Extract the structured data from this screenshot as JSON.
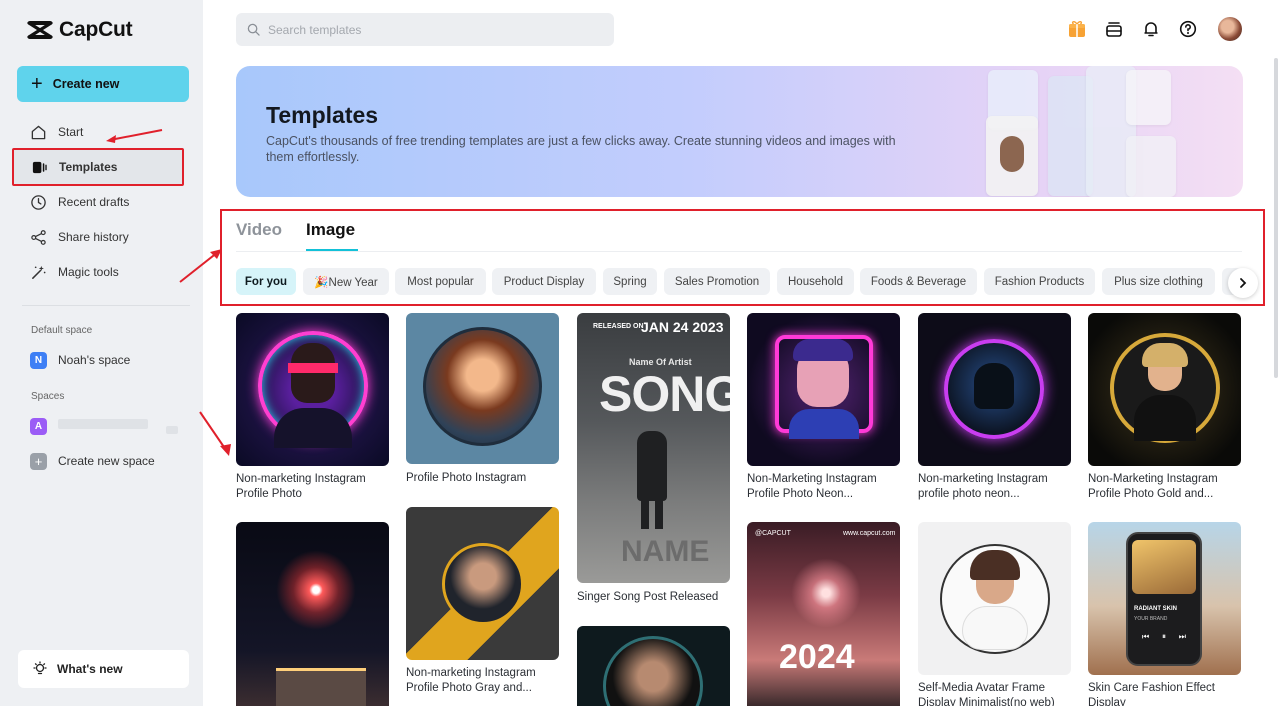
{
  "app": {
    "logo_text": "CapCut"
  },
  "sidebar": {
    "create_label": "Create new",
    "nav": [
      {
        "label": "Start",
        "icon": "home-icon"
      },
      {
        "label": "Templates",
        "icon": "templates-icon"
      },
      {
        "label": "Recent drafts",
        "icon": "clock-icon"
      },
      {
        "label": "Share history",
        "icon": "share-icon"
      },
      {
        "label": "Magic tools",
        "icon": "magic-wand-icon"
      }
    ],
    "default_space_label": "Default space",
    "default_space": {
      "badge": "N",
      "name": "Noah's space",
      "color": "#3d7ff5"
    },
    "spaces_label": "Spaces",
    "spaces_badge": "A",
    "spaces_badge_color": "#9b5cf6",
    "create_space_label": "Create new space",
    "whats_new_label": "What's new"
  },
  "header": {
    "search_placeholder": "Search templates"
  },
  "banner": {
    "title": "Templates",
    "description": "CapCut's thousands of free trending templates are just a few clicks away. Create stunning videos and images with them effortlessly."
  },
  "tabs": [
    {
      "label": "Video",
      "active": false
    },
    {
      "label": "Image",
      "active": true
    }
  ],
  "chips": [
    "For you",
    "🎉New Year",
    "Most popular",
    "Product Display",
    "Spring",
    "Sales Promotion",
    "Household",
    "Foods & Beverage",
    "Fashion Products",
    "Plus size clothing"
  ],
  "templates": [
    {
      "caption": "Non-marketing Instagram Profile Photo"
    },
    {
      "caption": "Profile Photo Instagram"
    },
    {
      "caption": "Singer Song Post Released",
      "overlay_top": "RELEASED ON",
      "overlay_date": "JAN 24 2023",
      "overlay_artist": "Name Of Artist",
      "overlay_title": "SONG",
      "overlay_name": "NAME"
    },
    {
      "caption": "Non-Marketing Instagram Profile Photo Neon..."
    },
    {
      "caption": "Non-marketing Instagram profile photo neon..."
    },
    {
      "caption": "Non-Marketing Instagram Profile Photo Gold and..."
    },
    {
      "caption": ""
    },
    {
      "caption": "Non-marketing Instagram Profile Photo Gray and..."
    },
    {
      "caption": ""
    },
    {
      "caption": "",
      "overlay_brand": "@CAPCUT",
      "overlay_site": "www.capcut.com",
      "overlay_year": "2024"
    },
    {
      "caption": "Self-Media Avatar Frame Display Minimalist(no web)"
    },
    {
      "caption": "Skin Care Fashion Effect Display",
      "overlay_line1": "RADIANT SKIN",
      "overlay_line2": "YOUR BRAND"
    }
  ],
  "colors": {
    "accent": "#13c1d8",
    "create_button": "#5fd3ec",
    "annotation_red": "#e0202b",
    "gift": "#f7a234"
  }
}
